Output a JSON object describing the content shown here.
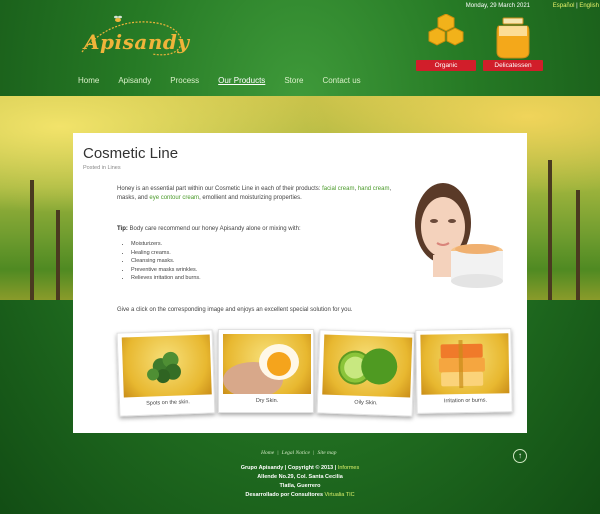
{
  "header": {
    "date": "Monday, 29 March 2021",
    "lang_es": "Español",
    "lang_sep": "|",
    "lang_en": "English",
    "logo_text": "Apisandy"
  },
  "nav": {
    "items": [
      "Home",
      "Apisandy",
      "Process",
      "Our Products",
      "Store",
      "Contact us"
    ]
  },
  "badges": {
    "organic": "Organic",
    "delicatessen": "Delicatessen"
  },
  "article": {
    "title": "Cosmetic Line",
    "posted": "Posted in Lines",
    "intro_a": "Honey is an essential part within our Cosmetic Line in each of their products: ",
    "link_facial": "facial cream",
    "comma1": ", ",
    "link_hand": "hand cream",
    "intro_b": ", masks, and ",
    "link_eye": "eye contour cream",
    "intro_c": ", emollient and moisturizing properties.",
    "tip_label": "Tip:",
    "tip_text": " Body care recommend our honey Apisandy alone or mixing with:",
    "uses": [
      "Moisturizers.",
      "Healing creams.",
      "Cleansing masks.",
      "Preventive masks wrinkles.",
      "Relieves irritation and burns."
    ],
    "give": "Give a click on the corresponding image and enjoys an excellent special solution for you."
  },
  "cards": [
    {
      "caption": "Spots on the skin."
    },
    {
      "caption": "Dry Skin."
    },
    {
      "caption": "Oily Skin."
    },
    {
      "caption": "Irritation or burns."
    }
  ],
  "footer": {
    "links": [
      "Home",
      "Legal Notice",
      "Site map"
    ],
    "link_sep": "|",
    "copyright": "Grupo Apisandy | Copyright © 2013 | ",
    "informes": "Informes",
    "address1": "Allende No.29, Col. Santa Cecilia",
    "address2": "Tlatla, Guerrero",
    "dev": "Desarrollado por Consultores ",
    "dev_link": "Virtualia TIC"
  },
  "colors": {
    "brand_green": "#267a25",
    "link_green": "#4a9a2a",
    "ribbon_red": "#d11e2a",
    "honey": "#f0b43a"
  }
}
